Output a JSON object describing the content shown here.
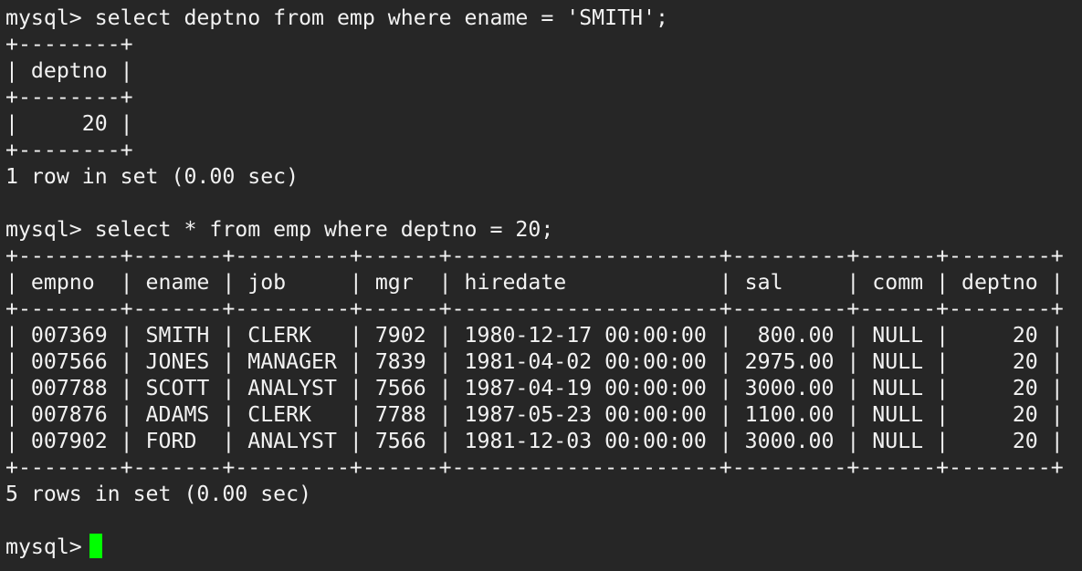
{
  "terminal": {
    "lines": [
      "mysql> select deptno from emp where ename = 'SMITH';",
      "+--------+",
      "| deptno |",
      "+--------+",
      "|     20 |",
      "+--------+",
      "1 row in set (0.00 sec)",
      "",
      "mysql> select * from emp where deptno = 20;",
      "+--------+-------+---------+------+---------------------+---------+------+--------+",
      "| empno  | ename | job     | mgr  | hiredate            | sal     | comm | deptno |",
      "+--------+-------+---------+------+---------------------+---------+------+--------+",
      "| 007369 | SMITH | CLERK   | 7902 | 1980-12-17 00:00:00 |  800.00 | NULL |     20 |",
      "| 007566 | JONES | MANAGER | 7839 | 1981-04-02 00:00:00 | 2975.00 | NULL |     20 |",
      "| 007788 | SCOTT | ANALYST | 7566 | 1987-04-19 00:00:00 | 3000.00 | NULL |     20 |",
      "| 007876 | ADAMS | CLERK   | 7788 | 1987-05-23 00:00:00 | 1100.00 | NULL |     20 |",
      "| 007902 | FORD  | ANALYST | 7566 | 1981-12-03 00:00:00 | 3000.00 | NULL |     20 |",
      "+--------+-------+---------+------+---------------------+---------+------+--------+",
      "5 rows in set (0.00 sec)",
      ""
    ],
    "prompt": "mysql>",
    "cursor_color": "#00ff00",
    "background": "#262626",
    "foreground": "#f2f2f2"
  }
}
